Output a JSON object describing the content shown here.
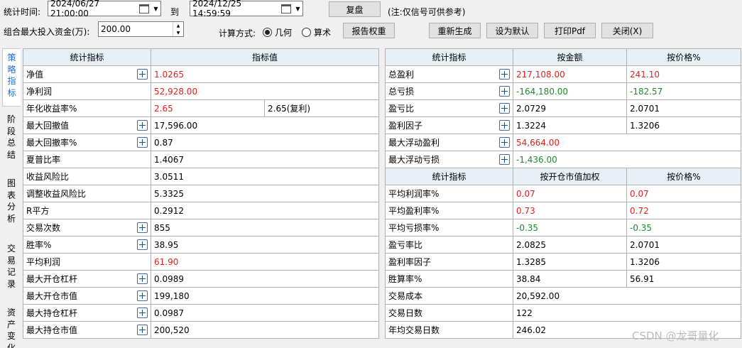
{
  "toolbar": {
    "period_label": "统计时间:",
    "start_date": "2024/06/27  21:00:00",
    "to_label": "到",
    "end_date": "2024/12/25  14:59:59",
    "review_button": "复盘",
    "note": "(注:仅信号可供参考)",
    "capital_label": "组合最大投入资金(万):",
    "capital_value": "200.00",
    "calc_label": "计算方式:",
    "calc_options": [
      "几何",
      "算术"
    ],
    "calc_selected": "几何",
    "report_weight_button": "报告权重",
    "regenerate_button": "重新生成",
    "set_default_button": "设为默认",
    "print_pdf_button": "打印Pdf",
    "close_button": "关闭(X)"
  },
  "tabs": [
    "策略指标",
    "阶段总结",
    "图表分析",
    "交易记录",
    "资产变化"
  ],
  "active_tab": "策略指标",
  "left_table": {
    "headers": [
      "统计指标",
      "指标值"
    ],
    "rows": [
      {
        "name": "净值",
        "value": "1.0265",
        "plus": true,
        "color": "red"
      },
      {
        "name": "净利润",
        "value": "52,928.00",
        "plus": false,
        "color": "red"
      },
      {
        "name": "年化收益率%",
        "value": "2.65",
        "extra": "2.65(复利)",
        "plus": false,
        "color": "red"
      },
      {
        "name": "最大回撤值",
        "value": "17,596.00",
        "plus": true,
        "color": ""
      },
      {
        "name": "最大回撤率%",
        "value": "0.87",
        "plus": true,
        "color": ""
      },
      {
        "name": "夏普比率",
        "value": "1.4067",
        "plus": false,
        "color": ""
      },
      {
        "name": "收益风险比",
        "value": "3.0511",
        "plus": false,
        "color": ""
      },
      {
        "name": "调整收益风险比",
        "value": "5.3325",
        "plus": false,
        "color": ""
      },
      {
        "name": "R平方",
        "value": "0.2912",
        "plus": false,
        "color": ""
      },
      {
        "name": "交易次数",
        "value": "855",
        "plus": true,
        "color": ""
      },
      {
        "name": "胜率%",
        "value": "38.95",
        "plus": true,
        "color": ""
      },
      {
        "name": "平均利润",
        "value": "61.90",
        "plus": false,
        "color": "red"
      },
      {
        "name": "最大开仓杠杆",
        "value": "0.0989",
        "plus": true,
        "color": ""
      },
      {
        "name": "最大开仓市值",
        "value": "199,180",
        "plus": true,
        "color": ""
      },
      {
        "name": "最大持仓杠杆",
        "value": "0.0987",
        "plus": true,
        "color": ""
      },
      {
        "name": "最大持仓市值",
        "value": "200,520",
        "plus": true,
        "color": ""
      }
    ]
  },
  "right_table_top": {
    "headers": [
      "统计指标",
      "按金额",
      "按价格%"
    ],
    "rows": [
      {
        "name": "总盈利",
        "amount": "217,108.00",
        "pct": "241.10",
        "plus": true,
        "color": "red"
      },
      {
        "name": "总亏损",
        "amount": "-164,180.00",
        "pct": "-182.57",
        "plus": true,
        "color": "green"
      },
      {
        "name": "盈亏比",
        "amount": "2.0729",
        "pct": "2.0701",
        "plus": true,
        "color": ""
      },
      {
        "name": "盈利因子",
        "amount": "1.3224",
        "pct": "1.3206",
        "plus": true,
        "color": ""
      },
      {
        "name": "最大浮动盈利",
        "amount": "54,664.00",
        "pct": "",
        "plus": true,
        "color": "red"
      },
      {
        "name": "最大浮动亏损",
        "amount": "-1,436.00",
        "pct": "",
        "plus": true,
        "color": "green"
      }
    ]
  },
  "right_table_bottom": {
    "headers": [
      "统计指标",
      "按开仓市值加权",
      "按价格%"
    ],
    "rows": [
      {
        "name": "平均利润率%",
        "amount": "0.07",
        "pct": "0.07",
        "color": "red"
      },
      {
        "name": "平均盈利率%",
        "amount": "0.73",
        "pct": "0.72",
        "color": "red"
      },
      {
        "name": "平均亏损率%",
        "amount": "-0.35",
        "pct": "-0.35",
        "color": "green"
      },
      {
        "name": "盈亏率比",
        "amount": "2.0825",
        "pct": "2.0701",
        "color": ""
      },
      {
        "name": "盈利率因子",
        "amount": "1.3285",
        "pct": "1.3206",
        "color": ""
      },
      {
        "name": "胜算率%",
        "amount": "38.84",
        "pct": "56.91",
        "color": ""
      },
      {
        "name": "交易成本",
        "amount": "20,592.00",
        "pct": null,
        "color": ""
      },
      {
        "name": "交易日数",
        "amount": "122",
        "pct": null,
        "color": ""
      },
      {
        "name": "年均交易日数",
        "amount": "246.02",
        "pct": null,
        "color": ""
      }
    ]
  },
  "watermark": "CSDN @龙哥量化"
}
